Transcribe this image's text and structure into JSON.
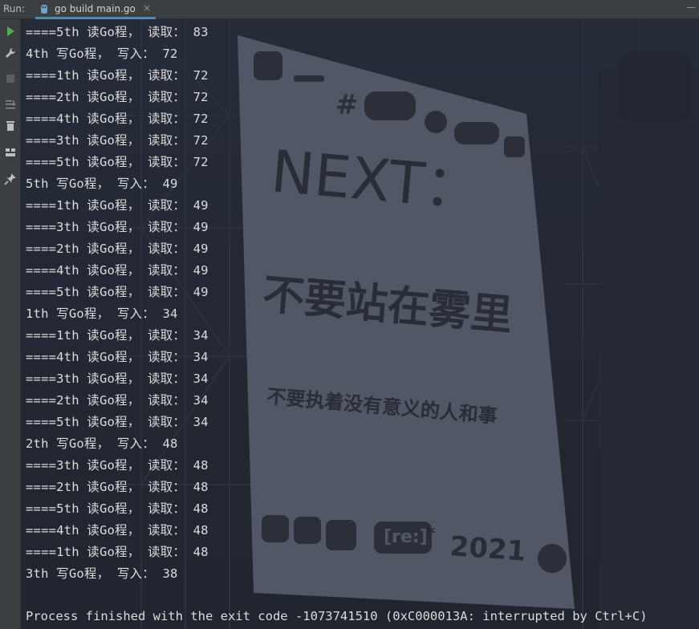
{
  "run_panel": {
    "label": "Run:",
    "tab_title": "go build main.go",
    "tab_close": "×",
    "menu": "—"
  },
  "toolbar": {
    "items": [
      {
        "name": "rerun-icon",
        "color": "#4caf50"
      },
      {
        "name": "wrench-icon"
      },
      {
        "name": "stop-icon"
      },
      {
        "name": "scroll-to-end-icon"
      },
      {
        "name": "trash-icon"
      },
      {
        "name": "layout-icon"
      },
      {
        "name": "pin-icon"
      }
    ]
  },
  "console": {
    "lines": [
      "====5th 读Go程， 读取： 83",
      "4th 写Go程， 写入： 72",
      "====1th 读Go程， 读取： 72",
      "====2th 读Go程， 读取： 72",
      "====4th 读Go程， 读取： 72",
      "====3th 读Go程， 读取： 72",
      "====5th 读Go程， 读取： 72",
      "5th 写Go程， 写入： 49",
      "====1th 读Go程， 读取： 49",
      "====3th 读Go程， 读取： 49",
      "====2th 读Go程， 读取： 49",
      "====4th 读Go程， 读取： 49",
      "====5th 读Go程， 读取： 49",
      "1th 写Go程， 写入： 34",
      "====1th 读Go程， 读取： 34",
      "====4th 读Go程， 读取： 34",
      "====3th 读Go程， 读取： 34",
      "====2th 读Go程， 读取： 34",
      "====5th 读Go程， 读取： 34",
      "2th 写Go程， 写入： 48",
      "====3th 读Go程， 读取： 48",
      "====2th 读Go程， 读取： 48",
      "====5th 读Go程， 读取： 48",
      "====4th 读Go程， 读取： 48",
      "====1th 读Go程， 读取： 48",
      "3th 写Go程， 写入： 38"
    ],
    "process_message": "Process finished with the exit code -1073741510 (0xC000013A: interrupted by Ctrl+C)"
  },
  "background": {
    "headline": "NEXT：",
    "main_slogan": "不要站在雾里",
    "sub_slogan": "不要执着没有意义的人和事",
    "brand": "[re:]",
    "brand_sup": "tc",
    "year": "2021",
    "hash": "#"
  }
}
